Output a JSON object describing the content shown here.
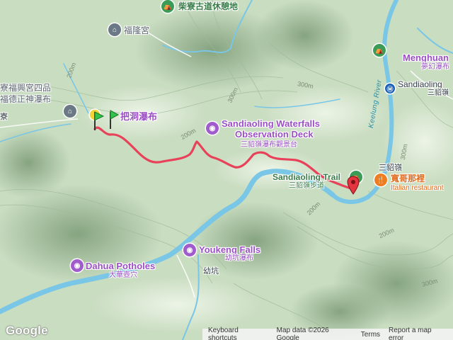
{
  "map": {
    "attribution": {
      "logo": "Google",
      "keyboard_shortcuts": "Keyboard shortcuts",
      "map_data": "Map data ©2026 Google",
      "terms": "Terms",
      "report": "Report a map error"
    },
    "labels": {
      "rest_area": "柴寮古道休憩地",
      "fulong_temple": "福隆宮",
      "temple_left_1": "寮福興宮四品",
      "temple_left_2": "福德正神瀑布",
      "left_edge": "寮",
      "pa_dong_falls": "把洞瀑布",
      "observation_en_1": "Sandiaoling Waterfalls",
      "observation_en_2": "Observation Deck",
      "observation_zh": "三貂嶺瀑布觀景台",
      "trail_en": "Sandiaoling Trail",
      "trail_zh": "三貂嶺步道",
      "sandiaoling_zh": "三貂嶺",
      "restaurant_zh": "寬哥那裡",
      "restaurant_en": "Italian restaurant",
      "menghuan_en": "Menghuan",
      "menghuan_zh": "夢幻瀑布",
      "station_en": "Sandiaoling",
      "station_zh": "三貂嶺",
      "keelung_river": "Keelung River",
      "youkeng_en": "Youkeng Falls",
      "youkeng_zh": "幼坑瀑布",
      "youkeng_place": "幼坑",
      "dahua_en": "Dahua Potholes",
      "dahua_zh": "大華壺穴"
    },
    "elevations": [
      "300m",
      "300m",
      "200m",
      "200m",
      "200m",
      "300m",
      "200m",
      "300m"
    ],
    "colors": {
      "route": "#e8425a",
      "river": "#6fc3e6",
      "terrain_light": "#d7e8cf",
      "terrain_dark": "#8fae8a",
      "poi_purple": "#a05ccc",
      "poi_green": "#3c9b57",
      "poi_orange": "#ee7d22"
    },
    "icons": {
      "start_flag": "green-flag-marker-icon",
      "end_pin": "red-pin-marker-icon",
      "camera": "camera-icon",
      "temple": "temple-icon",
      "park": "park-icon",
      "restaurant": "fork-knife-icon",
      "train": "train-station-icon"
    }
  }
}
